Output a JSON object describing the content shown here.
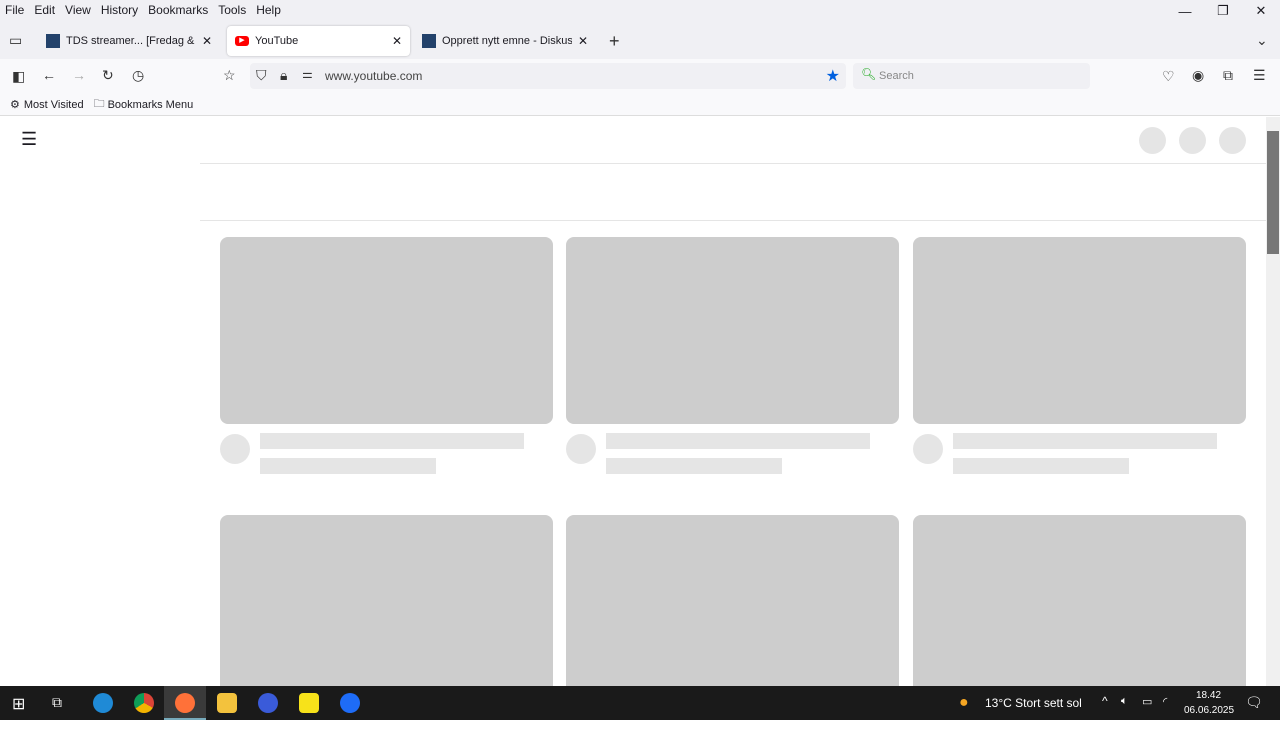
{
  "menu": [
    "File",
    "Edit",
    "View",
    "History",
    "Bookmarks",
    "Tools",
    "Help"
  ],
  "tabs": [
    {
      "title": "TDS streamer... [Fredag & Lørdag]",
      "active": false
    },
    {
      "title": "YouTube",
      "active": true
    },
    {
      "title": "Opprett nytt emne - Diskusjon.no",
      "active": false
    }
  ],
  "url": "www.youtube.com",
  "search_placeholder": "Search",
  "bookmarks": [
    "Most Visited",
    "Bookmarks Menu"
  ],
  "taskbar": {
    "weather": "13°C  Stort sett sol",
    "time": "18.42",
    "date": "06.06.2025"
  },
  "colors": {
    "youtube_red": "#ff0000",
    "bookmark_star": "#0060df",
    "skeleton": "#cdcdcd"
  }
}
